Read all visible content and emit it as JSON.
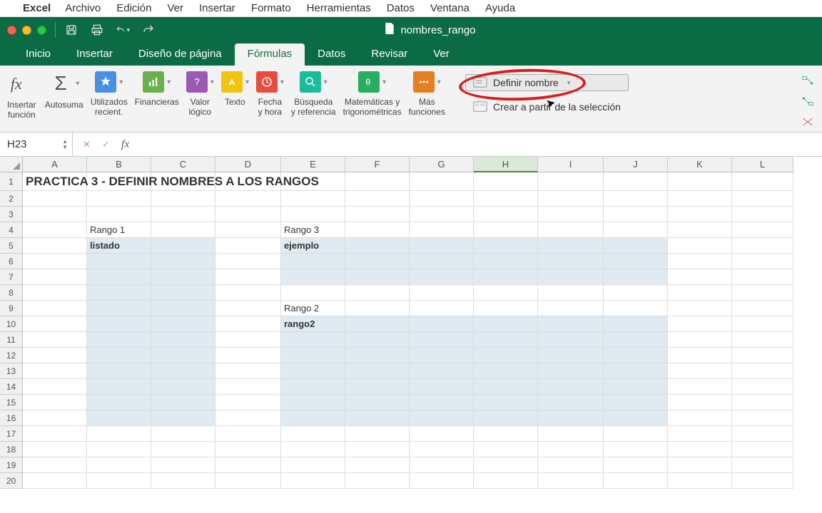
{
  "mac_menu": {
    "app": "Excel",
    "items": [
      "Archivo",
      "Edición",
      "Ver",
      "Insertar",
      "Formato",
      "Herramientas",
      "Datos",
      "Ventana",
      "Ayuda"
    ]
  },
  "doc_title": "nombres_rango",
  "tabs": [
    "Inicio",
    "Insertar",
    "Diseño de página",
    "Fórmulas",
    "Datos",
    "Revisar",
    "Ver"
  ],
  "active_tab": "Fórmulas",
  "ribbon": {
    "insert_fn": "Insertar\nfunción",
    "autosum": "Autosuma",
    "recent": "Utilizados\nrecient.",
    "financial": "Financieras",
    "logical": "Valor\nlógico",
    "text": "Texto",
    "datetime": "Fecha\ny hora",
    "lookup": "Búsqueda\ny referencia",
    "math": "Matemáticas y\ntrigonométricas",
    "more": "Más\nfunciones",
    "define_name": "Definir nombre",
    "create_from_sel": "Crear a partir de la selección"
  },
  "name_box": "H23",
  "columns": [
    "A",
    "B",
    "C",
    "D",
    "E",
    "F",
    "G",
    "H",
    "I",
    "J",
    "K",
    "L"
  ],
  "selected_col": "H",
  "rows": 20,
  "cells": {
    "title": "PRACTICA 3 - DEFINIR NOMBRES A LOS RANGOS",
    "b4": "Rango 1",
    "b5": "listado",
    "e4": "Rango 3",
    "e5": "ejemplo",
    "e9": "Rango 2",
    "e10": "rango2"
  }
}
